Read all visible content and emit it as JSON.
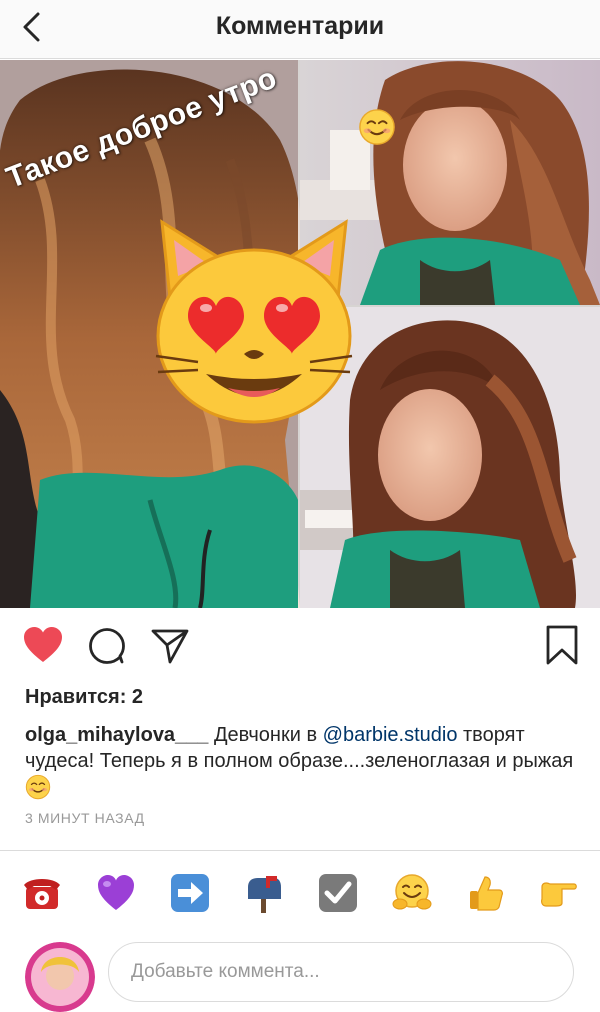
{
  "header": {
    "title": "Комментарии",
    "back_icon": "chevron-left-icon"
  },
  "post": {
    "overlay_text": "Такое доброе утро",
    "overlay_emoji": "smiling-face-icon",
    "sticker": "smiling-cat-heart-eyes-icon"
  },
  "actions": {
    "like_icon": "heart-filled-icon",
    "comment_icon": "speech-bubble-icon",
    "share_icon": "paper-plane-icon",
    "save_icon": "bookmark-icon",
    "liked": true
  },
  "likes_text": "Нравится: 2",
  "caption": {
    "username": "olga_mihaylova___",
    "text_before": " Девчонки в ",
    "mention": "@barbie.studio",
    "text_after": " творят чудеса! Теперь я в полном образе....зеленоглазая и рыжая"
  },
  "time_ago": "3 МИНУТ НАЗАД",
  "quick_emojis": [
    "telephone-icon",
    "purple-heart-icon",
    "right-arrow-icon",
    "mailbox-icon",
    "check-mark-icon",
    "hugging-face-icon",
    "thumbs-up-icon",
    "pointing-right-icon"
  ],
  "comment_input": {
    "placeholder": "Добавьте коммента..."
  },
  "colors": {
    "like_red": "#ed4956",
    "mention_blue": "#003569",
    "meta_gray": "#999999",
    "jacket_green": "#1e9e7e"
  }
}
